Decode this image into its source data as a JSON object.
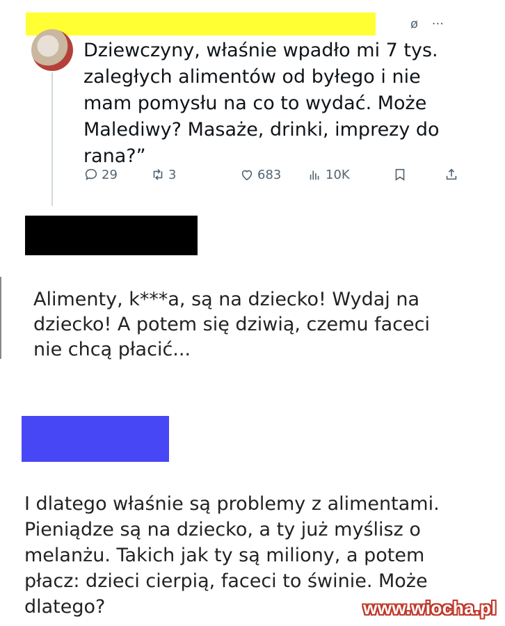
{
  "tweet": {
    "text": "Dziewczyny, właśnie wpadło mi 7 tys.\nzaległych alimentów od byłego i nie\nmam pomysłu na co to wydać. Może\nMalediwy? Masaże, drinki, imprezy do\nrana?”",
    "replies": "29",
    "retweets": "3",
    "likes": "683",
    "views": "10K",
    "top_icons": [
      "grok-icon",
      "more-icon"
    ]
  },
  "comment1": {
    "text": "Alimenty, k***a, są na dziecko! Wydaj na\ndziecko! A potem się dziwią, czemu faceci\nnie chcą płacić..."
  },
  "comment2": {
    "text": "I dlatego właśnie są problemy z alimentami.\nPieniądze są na dziecko, a ty już myślisz o\nmelanżu. Takich jak ty są miliony, a potem\npłacz: dzieci cierpią, faceci to świnie. Może\ndlatego?"
  },
  "redactions": {
    "colors": {
      "yellow": "#ffff33",
      "black": "#000000",
      "blue": "#4747f5"
    }
  },
  "watermark": "www.wiocha.pl"
}
